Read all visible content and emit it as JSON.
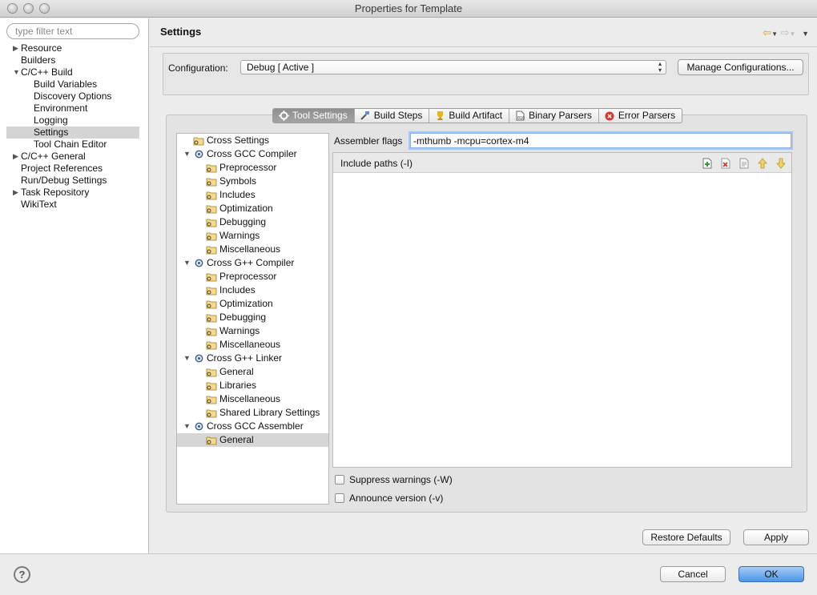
{
  "window": {
    "title": "Properties for Template"
  },
  "sidebar": {
    "filter_placeholder": "type filter text",
    "items": [
      {
        "label": "Resource",
        "arrow": "▶"
      },
      {
        "label": "Builders",
        "arrow": ""
      },
      {
        "label": "C/C++ Build",
        "arrow": "▼"
      },
      {
        "label": "Build Variables",
        "arrow": ""
      },
      {
        "label": "Discovery Options",
        "arrow": ""
      },
      {
        "label": "Environment",
        "arrow": ""
      },
      {
        "label": "Logging",
        "arrow": ""
      },
      {
        "label": "Settings",
        "arrow": ""
      },
      {
        "label": "Tool Chain Editor",
        "arrow": ""
      },
      {
        "label": "C/C++ General",
        "arrow": "▶"
      },
      {
        "label": "Project References",
        "arrow": ""
      },
      {
        "label": "Run/Debug Settings",
        "arrow": ""
      },
      {
        "label": "Task Repository",
        "arrow": "▶"
      },
      {
        "label": "WikiText",
        "arrow": ""
      }
    ]
  },
  "header": {
    "title": "Settings"
  },
  "config": {
    "label": "Configuration:",
    "value": "Debug  [ Active ]",
    "manage_label": "Manage Configurations..."
  },
  "tabs": [
    {
      "label": "Tool Settings"
    },
    {
      "label": "Build Steps"
    },
    {
      "label": "Build Artifact"
    },
    {
      "label": "Binary Parsers"
    },
    {
      "label": "Error Parsers"
    }
  ],
  "tree": {
    "items": [
      {
        "label": "Cross Settings"
      },
      {
        "label": "Cross GCC Compiler",
        "arrow": "▼"
      },
      {
        "label": "Preprocessor"
      },
      {
        "label": "Symbols"
      },
      {
        "label": "Includes"
      },
      {
        "label": "Optimization"
      },
      {
        "label": "Debugging"
      },
      {
        "label": "Warnings"
      },
      {
        "label": "Miscellaneous"
      },
      {
        "label": "Cross G++ Compiler",
        "arrow": "▼"
      },
      {
        "label": "Preprocessor"
      },
      {
        "label": "Includes"
      },
      {
        "label": "Optimization"
      },
      {
        "label": "Debugging"
      },
      {
        "label": "Warnings"
      },
      {
        "label": "Miscellaneous"
      },
      {
        "label": "Cross G++ Linker",
        "arrow": "▼"
      },
      {
        "label": "General"
      },
      {
        "label": "Libraries"
      },
      {
        "label": "Miscellaneous"
      },
      {
        "label": "Shared Library Settings"
      },
      {
        "label": "Cross GCC Assembler",
        "arrow": "▼"
      },
      {
        "label": "General"
      }
    ]
  },
  "assembler": {
    "flags_label": "Assembler flags",
    "flags_value": "-mthumb -mcpu=cortex-m4",
    "include_paths_label": "Include paths (-I)",
    "suppress_warnings_label": "Suppress warnings (-W)",
    "announce_version_label": "Announce version (-v)"
  },
  "buttons": {
    "restore_defaults": "Restore Defaults",
    "apply": "Apply",
    "cancel": "Cancel",
    "ok": "OK",
    "help": "?"
  },
  "colors": {
    "accent": "#3b7ddd",
    "selection": "#d6d6d6",
    "input_focus": "#a8c7ee"
  }
}
